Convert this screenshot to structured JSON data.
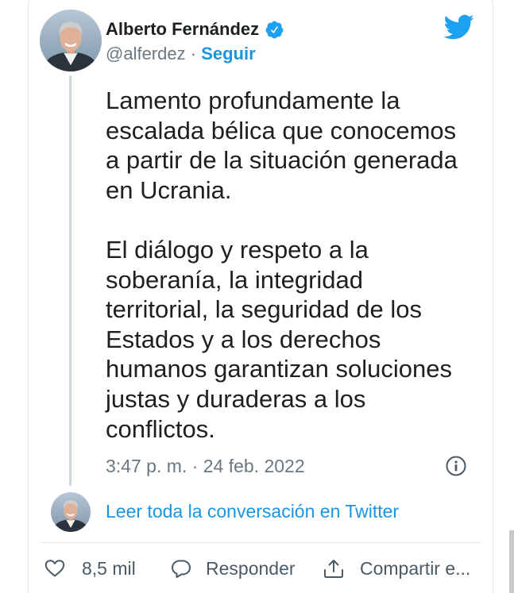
{
  "tweet": {
    "author": {
      "name": "Alberto Fernández",
      "verified": true,
      "handle": "@alferdez",
      "separator": "·",
      "follow_label": "Seguir"
    },
    "text_paragraphs": [
      {
        "lines": [
          "Lamento profundamente la",
          "escalada bélica que conocemos",
          "a partir de la situación generada",
          "en Ucrania."
        ]
      },
      {
        "lines": [
          "El diálogo y respeto a la",
          "soberanía, la integridad",
          "territorial, la seguridad de los",
          "Estados y a los derechos",
          "humanos garantizan soluciones",
          "justas y duraderas a los",
          "conflictos."
        ]
      }
    ],
    "timestamp": "3:47 p. m. · 24 feb. 2022"
  },
  "conversation": {
    "link_label": "Leer toda la conversación en Twitter"
  },
  "actions": {
    "like": {
      "icon": "heart-icon",
      "count": "8,5 mil"
    },
    "reply": {
      "icon": "speech-bubble-icon",
      "label": "Responder"
    },
    "share": {
      "icon": "share-icon",
      "label": "Compartir e..."
    }
  },
  "icons": {
    "logo": "twitter-bird-icon",
    "verified": "verified-badge-icon",
    "info": "info-icon",
    "avatar": "profile-photo"
  },
  "colors": {
    "text": "#1c2022",
    "secondary": "#697882",
    "link": "#1b95e0",
    "brand": "#1da1f2",
    "thread_line": "#ccd6dd",
    "divider": "#e1e8ed"
  }
}
